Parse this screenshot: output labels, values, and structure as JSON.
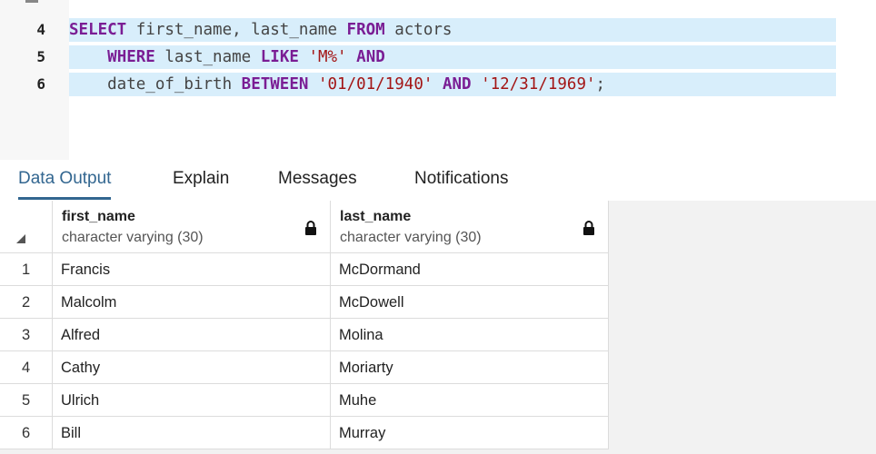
{
  "editor": {
    "lines": [
      {
        "num": "4",
        "tokens": [
          {
            "t": "SELECT",
            "k": "kw"
          },
          {
            "t": " first_name, last_name ",
            "k": "id"
          },
          {
            "t": "FROM",
            "k": "kw"
          },
          {
            "t": " actors",
            "k": "id"
          }
        ]
      },
      {
        "num": "5",
        "tokens": [
          {
            "t": "    ",
            "k": "id"
          },
          {
            "t": "WHERE",
            "k": "kw"
          },
          {
            "t": " last_name ",
            "k": "id"
          },
          {
            "t": "LIKE",
            "k": "kw"
          },
          {
            "t": " ",
            "k": "id"
          },
          {
            "t": "'M%'",
            "k": "str"
          },
          {
            "t": " ",
            "k": "id"
          },
          {
            "t": "AND",
            "k": "kw"
          }
        ]
      },
      {
        "num": "6",
        "tokens": [
          {
            "t": "    date_of_birth ",
            "k": "id"
          },
          {
            "t": "BETWEEN",
            "k": "kw"
          },
          {
            "t": " ",
            "k": "id"
          },
          {
            "t": "'01/01/1940'",
            "k": "str"
          },
          {
            "t": " ",
            "k": "id"
          },
          {
            "t": "AND",
            "k": "kw"
          },
          {
            "t": " ",
            "k": "id"
          },
          {
            "t": "'12/31/1969'",
            "k": "str"
          },
          {
            "t": ";",
            "k": "id"
          }
        ]
      }
    ]
  },
  "tabs": [
    {
      "label": "Data Output",
      "active": true
    },
    {
      "label": "Explain",
      "active": false
    },
    {
      "label": "Messages",
      "active": false
    },
    {
      "label": "Notifications",
      "active": false
    }
  ],
  "grid": {
    "columns": [
      {
        "name": "first_name",
        "type": "character varying (30)",
        "locked": true,
        "icon": "lock-icon"
      },
      {
        "name": "last_name",
        "type": "character varying (30)",
        "locked": true,
        "icon": "lock-icon"
      }
    ],
    "rows": [
      {
        "num": "1",
        "first_name": "Francis",
        "last_name": "McDormand"
      },
      {
        "num": "2",
        "first_name": "Malcolm",
        "last_name": "McDowell"
      },
      {
        "num": "3",
        "first_name": "Alfred",
        "last_name": "Molina"
      },
      {
        "num": "4",
        "first_name": "Cathy",
        "last_name": "Moriarty"
      },
      {
        "num": "5",
        "first_name": "Ulrich",
        "last_name": "Muhe"
      },
      {
        "num": "6",
        "first_name": "Bill",
        "last_name": "Murray"
      }
    ]
  },
  "colors": {
    "keyword": "#7a1d94",
    "string": "#a31515",
    "selection": "#d8eefb",
    "active_tab": "#326690"
  }
}
